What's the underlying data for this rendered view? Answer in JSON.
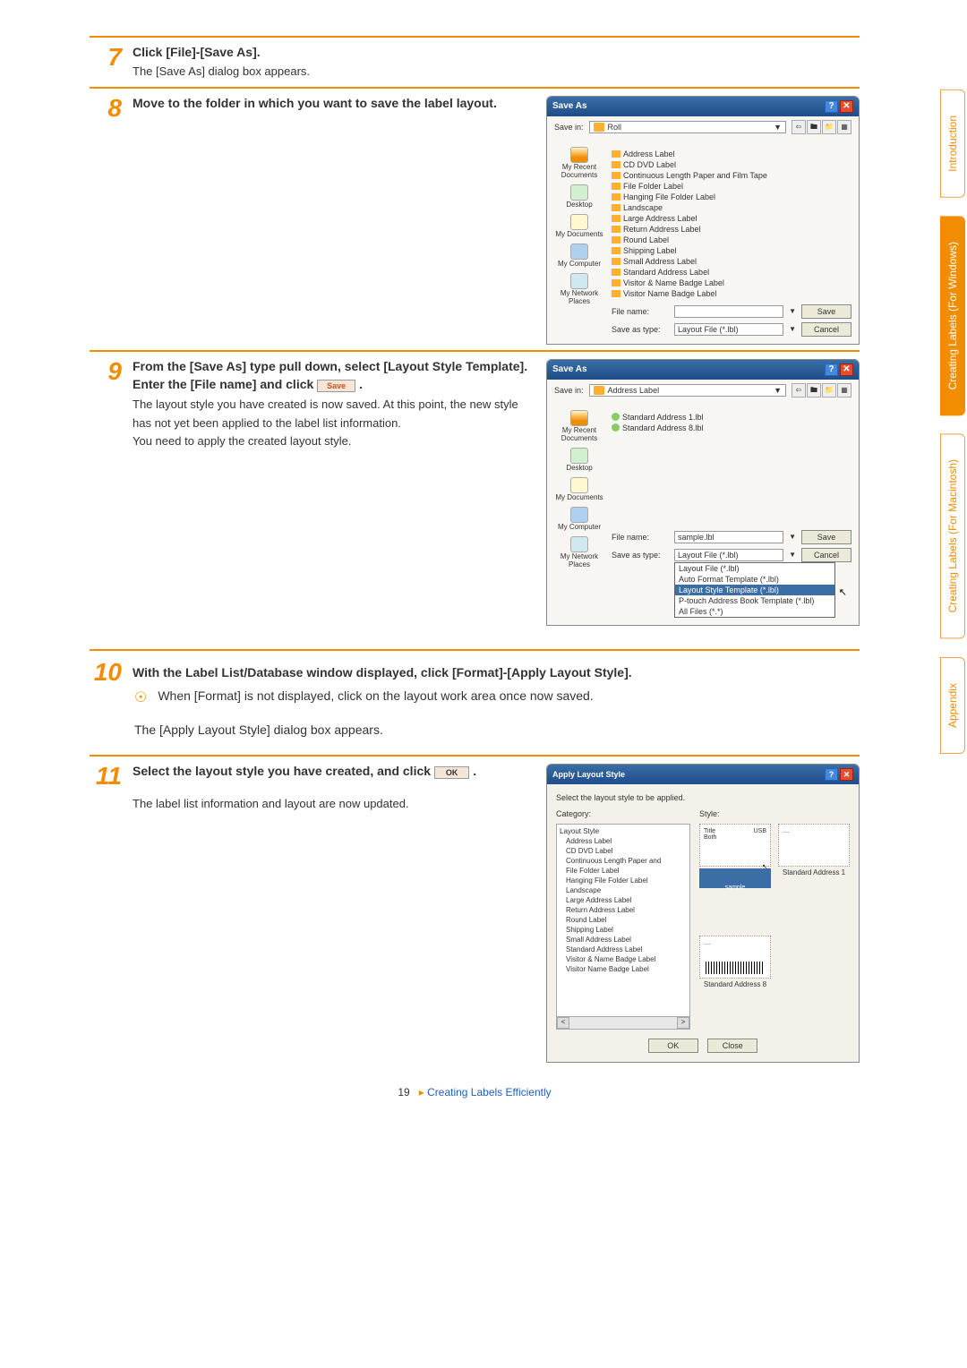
{
  "steps": {
    "s7": {
      "num": "7",
      "title": "Click [File]-[Save As].",
      "desc": "The [Save As] dialog box appears."
    },
    "s8": {
      "num": "8",
      "title": "Move to the folder in which you want to save the label layout."
    },
    "s9": {
      "num": "9",
      "title_a": "From the [Save As] type pull down, select [Layout Style Template].",
      "title_b": "Enter the [File name] and click ",
      "save_btn": "Save",
      "desc": "The layout style you have created is now saved. At this point, the new style has not yet been applied to the label list information.\nYou need to apply the created layout style."
    },
    "s10": {
      "num": "10",
      "title": "With the Label List/Database window displayed, click [Format]-[Apply Layout Style]."
    },
    "tip": "When [Format] is not displayed, click on the layout work area once now saved.",
    "after10": "The [Apply Layout Style] dialog box appears.",
    "s11": {
      "num": "11",
      "title": "Select the layout style you have created, and click ",
      "ok_btn": "OK",
      "desc": "The label list information and layout are now updated."
    }
  },
  "saveas1": {
    "title": "Save As",
    "savein_label": "Save in:",
    "savein_val": "Roll",
    "sidebar": [
      "My Recent Documents",
      "Desktop",
      "My Documents",
      "My Computer",
      "My Network Places"
    ],
    "files": [
      "Address Label",
      "CD DVD Label",
      "Continuous Length Paper and Film Tape",
      "File Folder Label",
      "Hanging File Folder Label",
      "Landscape",
      "Large Address Label",
      "Return Address Label",
      "Round Label",
      "Shipping Label",
      "Small Address Label",
      "Standard Address Label",
      "Visitor & Name Badge Label",
      "Visitor Name Badge Label"
    ],
    "file_label": "File name:",
    "file_val": "",
    "type_label": "Save as type:",
    "type_val": "Layout File (*.lbl)",
    "save": "Save",
    "cancel": "Cancel"
  },
  "saveas2": {
    "title": "Save As",
    "savein_label": "Save in:",
    "savein_val": "Address Label",
    "files": [
      "Standard Address 1.lbl",
      "Standard Address 8.lbl"
    ],
    "file_label": "File name:",
    "file_val": "sample.lbl",
    "type_label": "Save as type:",
    "type_val": "Layout File (*.lbl)",
    "save": "Save",
    "cancel": "Cancel",
    "dropdown": [
      "Layout File (*.lbl)",
      "Auto Format Template (*.lbl)",
      "Layout Style Template (*.lbl)",
      "P-touch Address Book Template (*.lbl)",
      "All Files (*.*)"
    ],
    "dropdown_highlight": "Layout Style Template (*.lbl)"
  },
  "apply": {
    "title": "Apply Layout Style",
    "instruction": "Select the layout style to be applied.",
    "cat_label": "Category:",
    "style_label": "Style:",
    "cats_root": "Layout Style",
    "cats": [
      "Address Label",
      "CD DVD Label",
      "Continuous Length Paper and",
      "File Folder Label",
      "Hanging File Folder Label",
      "Landscape",
      "Large Address Label",
      "Return Address Label",
      "Round Label",
      "Shipping Label",
      "Small Address Label",
      "Standard Address Label",
      "Visitor & Name Badge Label",
      "Visitor Name Badge Label"
    ],
    "previews": [
      {
        "name": "sample",
        "type": "bar",
        "text1": "Title",
        "text2": "Both"
      },
      {
        "name": "Standard Address 1",
        "type": "plain"
      },
      {
        "name": "Standard Address 8",
        "type": "barcode"
      }
    ],
    "ok": "OK",
    "close": "Close"
  },
  "sidebar": {
    "intro": "Introduction",
    "win": "Creating Labels (For Windows)",
    "mac": "Creating Labels (For Macintosh)",
    "appx": "Appendix"
  },
  "footer": {
    "page": "19",
    "link": "Creating Labels Efficiently"
  }
}
